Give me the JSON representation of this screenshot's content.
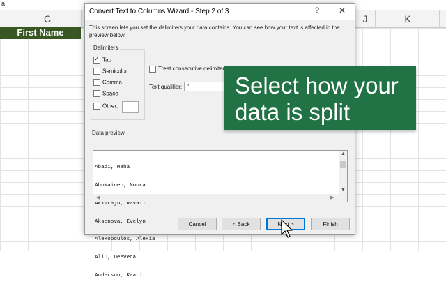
{
  "spreadsheet": {
    "formula_text": "a",
    "columns": [
      "C",
      "J",
      "K"
    ],
    "header_cell": "First Name"
  },
  "dialog": {
    "title": "Convert Text to Columns Wizard - Step 2 of 3",
    "help_icon": "?",
    "close_icon": "✕",
    "intro": "This screen lets you set the delimiters your data contains.  You can see how your text is affected in the preview below.",
    "delimiters_label": "Delimiters",
    "delimiters": [
      {
        "label": "Tab",
        "checked": true
      },
      {
        "label": "Semicolon",
        "checked": false
      },
      {
        "label": "Comma",
        "checked": false
      },
      {
        "label": "Space",
        "checked": false
      },
      {
        "label": "Other:",
        "checked": false
      }
    ],
    "consecutive_label": "Treat consecutive delimiters a",
    "qualifier_label": "Text qualifier:",
    "qualifier_value": "\"",
    "preview_label": "Data preview",
    "preview_lines": [
      "Abadi, Maha",
      "Ahokainen, Noora",
      "Akkiraju, Ravali",
      "Aksenova, Evelyn",
      "Alexopoulos, Alexia",
      "Allu, Deevena",
      "Anderson, Kaari"
    ],
    "buttons": {
      "cancel": "Cancel",
      "back": "< Back",
      "next": "Next >",
      "finish": "Finish"
    }
  },
  "callout": {
    "text": "Select how your data is split",
    "color": "#217346"
  }
}
